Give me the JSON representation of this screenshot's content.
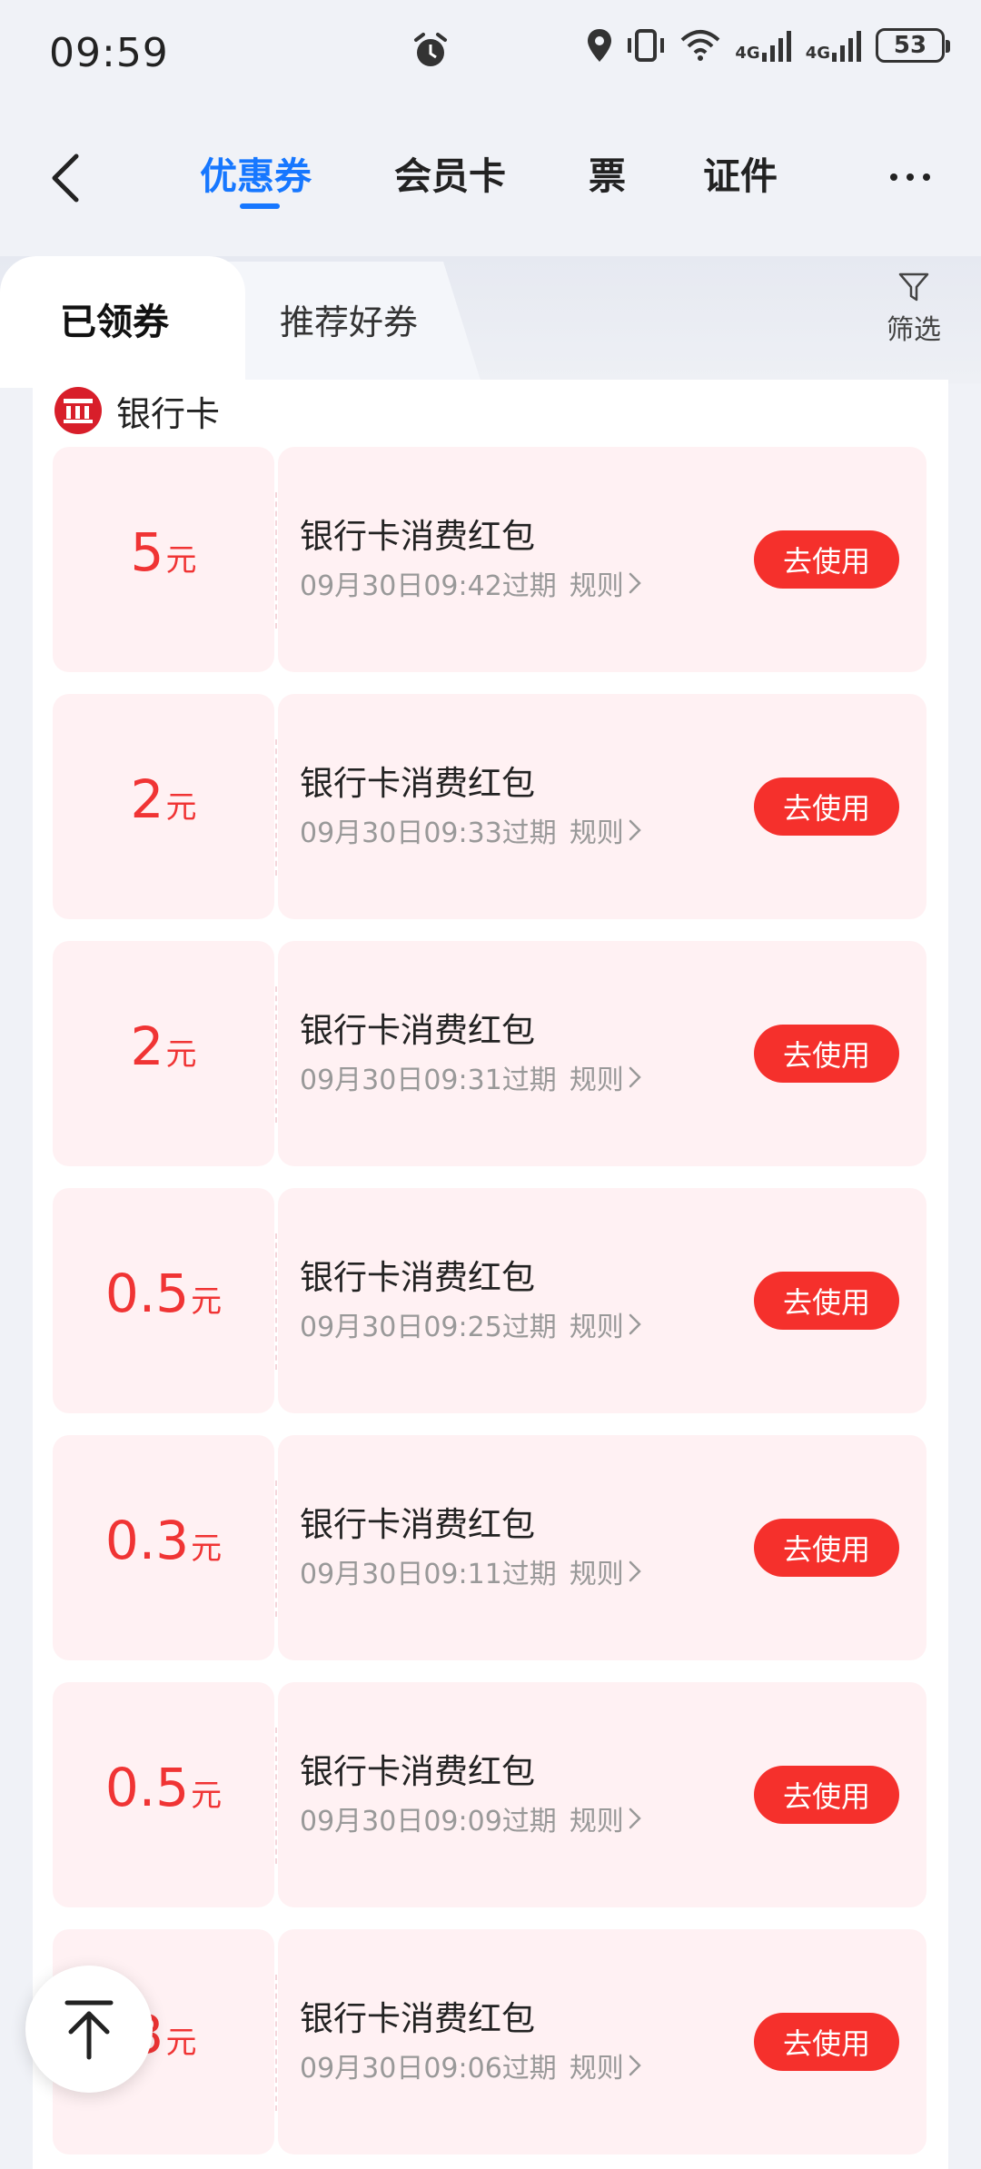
{
  "status_bar": {
    "time": "09:59",
    "network_1": "4G",
    "network_2": "4G",
    "battery": "53"
  },
  "nav": {
    "tabs": [
      {
        "label": "优惠券",
        "active": true
      },
      {
        "label": "会员卡",
        "active": false
      },
      {
        "label": "票",
        "active": false
      },
      {
        "label": "证件",
        "active": false
      }
    ],
    "accent_color": "#1677ff"
  },
  "subtabs": {
    "active": "已领券",
    "inactive": "推荐好券",
    "filter_label": "筛选"
  },
  "group": {
    "title": "银行卡",
    "logo_color": "#d81e2a"
  },
  "coupons": [
    {
      "amount": "5",
      "unit": "元",
      "title": "银行卡消费红包",
      "expiry": "09月30日09:42过期",
      "rules": "规则",
      "button": "去使用"
    },
    {
      "amount": "2",
      "unit": "元",
      "title": "银行卡消费红包",
      "expiry": "09月30日09:33过期",
      "rules": "规则",
      "button": "去使用"
    },
    {
      "amount": "2",
      "unit": "元",
      "title": "银行卡消费红包",
      "expiry": "09月30日09:31过期",
      "rules": "规则",
      "button": "去使用"
    },
    {
      "amount": "0.5",
      "unit": "元",
      "title": "银行卡消费红包",
      "expiry": "09月30日09:25过期",
      "rules": "规则",
      "button": "去使用"
    },
    {
      "amount": "0.3",
      "unit": "元",
      "title": "银行卡消费红包",
      "expiry": "09月30日09:11过期",
      "rules": "规则",
      "button": "去使用"
    },
    {
      "amount": "0.5",
      "unit": "元",
      "title": "银行卡消费红包",
      "expiry": "09月30日09:09过期",
      "rules": "规则",
      "button": "去使用"
    },
    {
      "amount": "3",
      "unit": "元",
      "title": "银行卡消费红包",
      "expiry": "09月30日09:06过期",
      "rules": "规则",
      "button": "去使用"
    }
  ],
  "colors": {
    "coupon_red": "#f03434",
    "button_red": "#f5302c",
    "coupon_bg": "#fff1f3"
  }
}
